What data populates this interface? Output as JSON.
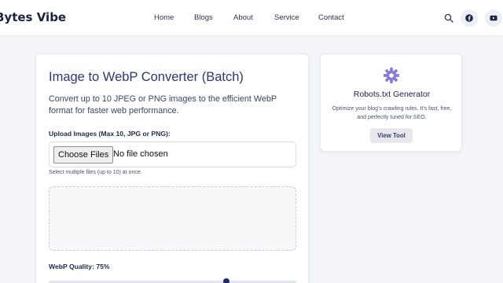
{
  "header": {
    "brand": "Bytes Vibe",
    "nav": [
      "Home",
      "Blogs",
      "About",
      "Service",
      "Contact"
    ],
    "icons": [
      "search-icon",
      "facebook-icon",
      "youtube-icon"
    ]
  },
  "converter": {
    "title": "Image to WebP Converter (Batch)",
    "description": "Convert up to 10 JPEG or PNG images to the efficient WebP format for faster web performance.",
    "upload_label": "Upload Images (Max 10, JPG or PNG):",
    "choose_button": "Choose Files",
    "file_status": "No file chosen",
    "hint": "Select multiple files (up to 10) at once.",
    "quality_label": "WebP Quality: 75%",
    "quality_value": 75
  },
  "sidebar_tool": {
    "icon": "gear-icon",
    "title": "Robots.txt Generator",
    "description": "Optimize your blog's crawling rules. It's fast, free, and perfectly tuned for SEO.",
    "button": "View Tool",
    "accent_color": "#8b7bd4"
  }
}
